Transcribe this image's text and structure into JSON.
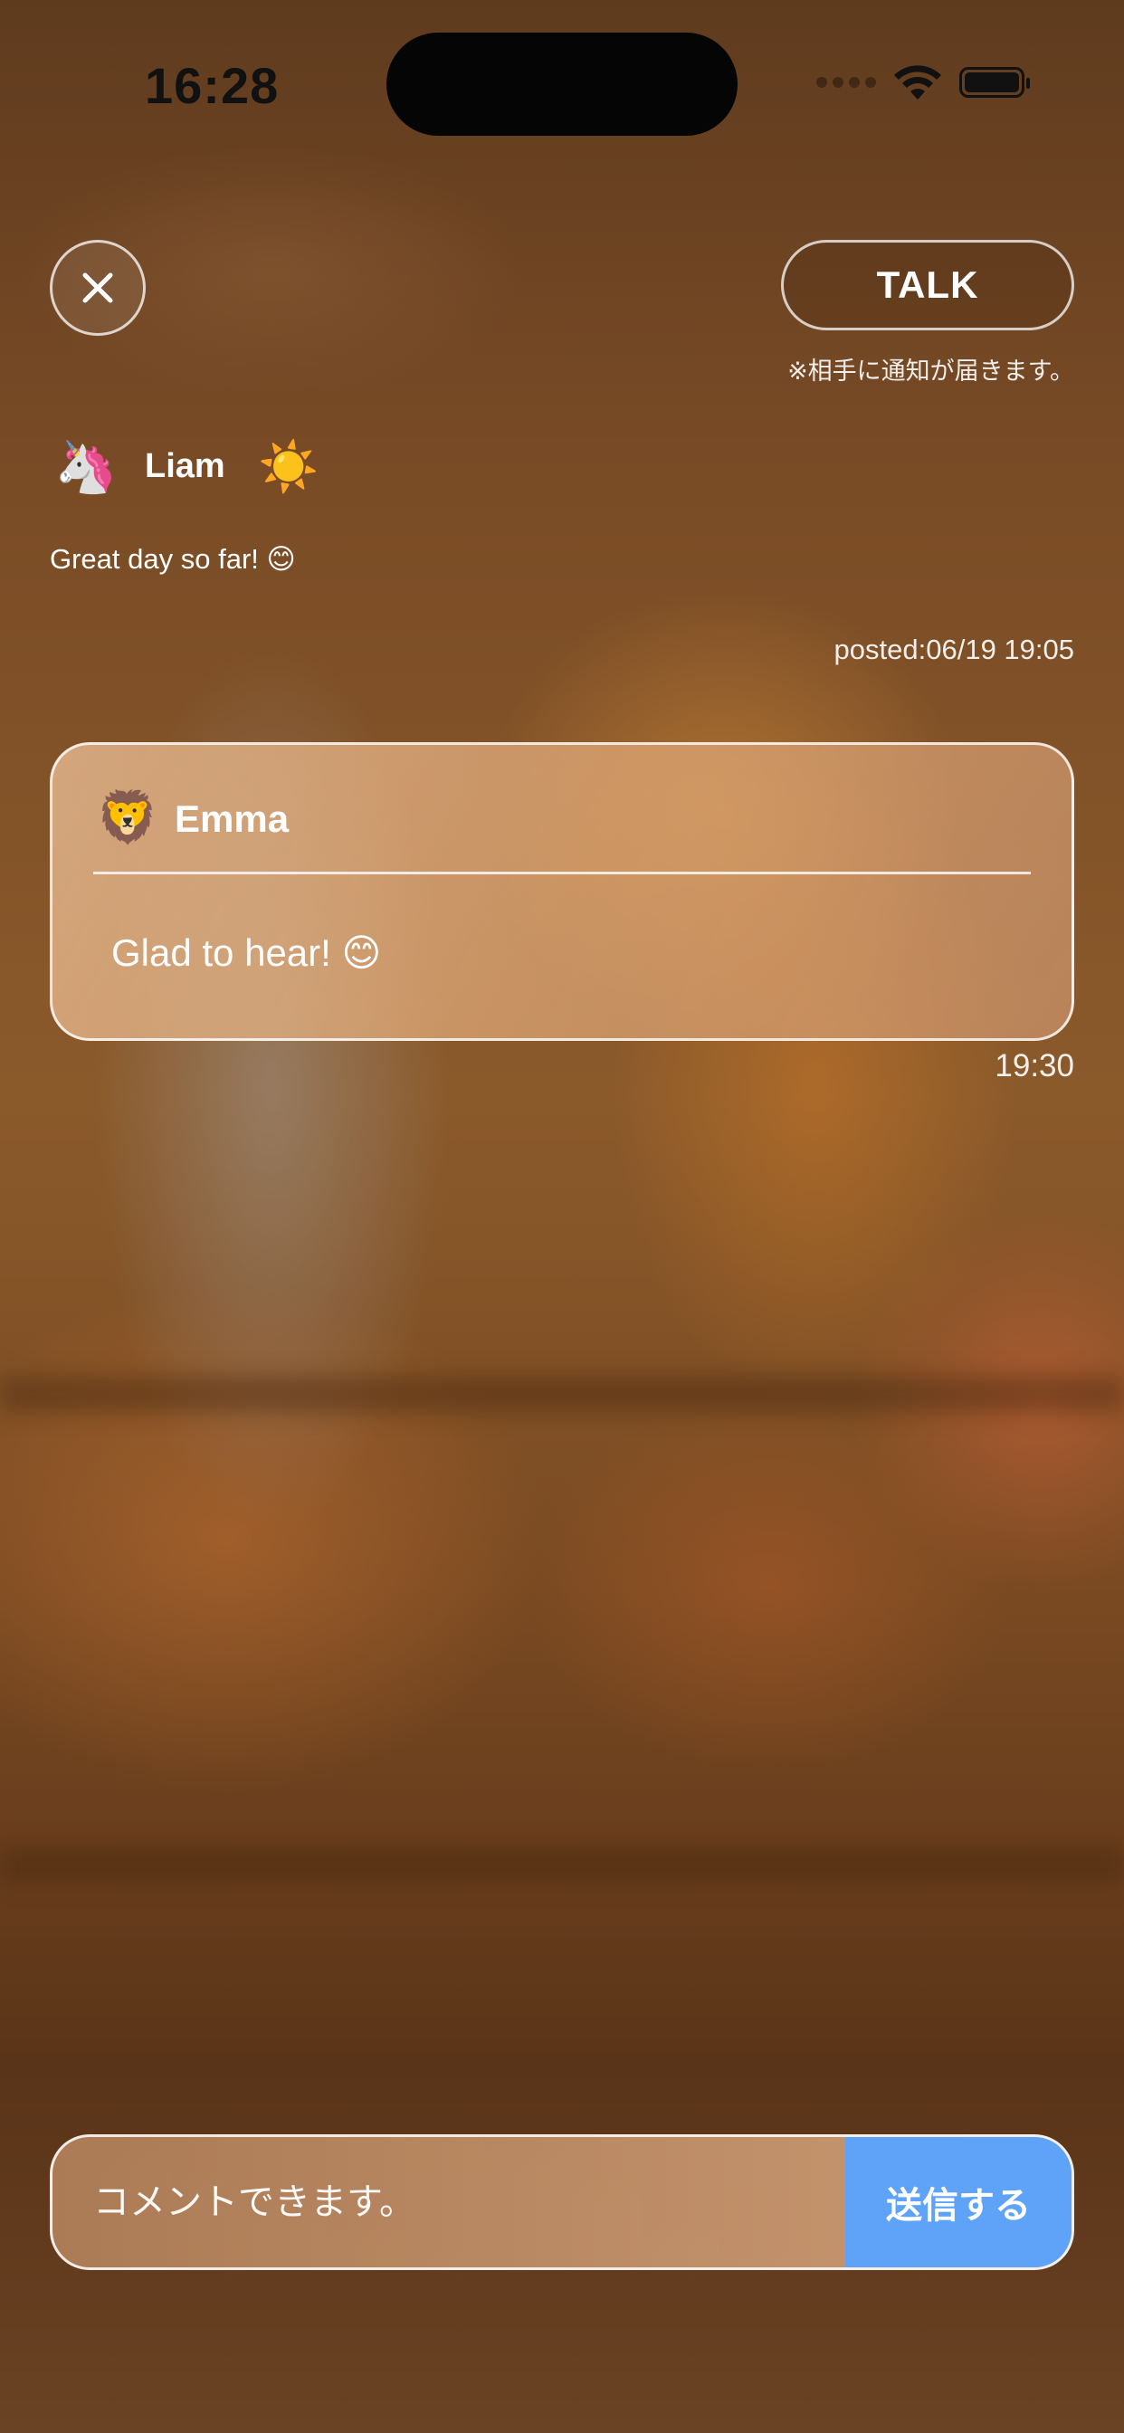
{
  "status_bar": {
    "time": "16:28"
  },
  "header": {
    "close_icon": "close-icon",
    "talk_label": "TALK",
    "notice": "※相手に通知が届きます。"
  },
  "post": {
    "avatar": "🦄",
    "username": "Liam",
    "mood": "☀️",
    "text": "Great day so far! 😊",
    "posted": "posted:06/19 19:05"
  },
  "comment": {
    "avatar": "🦁",
    "username": "Emma",
    "text": "Glad to hear! 😊",
    "time": "19:30"
  },
  "composer": {
    "placeholder": "コメントできます。",
    "send_label": "送信する"
  },
  "colors": {
    "send_button": "#5ea3f7"
  }
}
